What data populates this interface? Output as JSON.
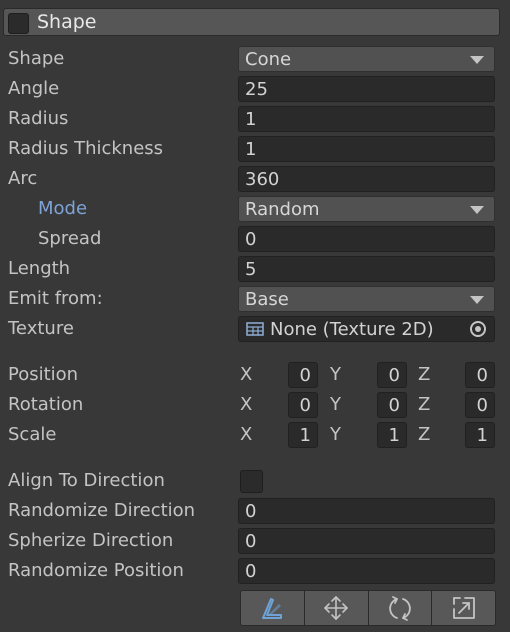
{
  "header": {
    "title": "Shape",
    "enabled": false
  },
  "fields": {
    "shape": {
      "label": "Shape",
      "value": "Cone"
    },
    "angle": {
      "label": "Angle",
      "value": "25"
    },
    "radius": {
      "label": "Radius",
      "value": "1"
    },
    "radius_thickness": {
      "label": "Radius Thickness",
      "value": "1"
    },
    "arc": {
      "label": "Arc",
      "value": "360"
    },
    "mode": {
      "label": "Mode",
      "value": "Random"
    },
    "spread": {
      "label": "Spread",
      "value": "0"
    },
    "length": {
      "label": "Length",
      "value": "5"
    },
    "emit_from": {
      "label": "Emit from:",
      "value": "Base"
    },
    "texture": {
      "label": "Texture",
      "value": "None (Texture 2D)"
    }
  },
  "transform": {
    "position": {
      "label": "Position",
      "x": "0",
      "y": "0",
      "z": "0"
    },
    "rotation": {
      "label": "Rotation",
      "x": "0",
      "y": "0",
      "z": "0"
    },
    "scale": {
      "label": "Scale",
      "x": "1",
      "y": "1",
      "z": "1"
    },
    "axis_labels": {
      "x": "X",
      "y": "Y",
      "z": "Z"
    }
  },
  "options": {
    "align_to_direction": {
      "label": "Align To Direction",
      "checked": false
    },
    "randomize_direction": {
      "label": "Randomize Direction",
      "value": "0"
    },
    "spherize_direction": {
      "label": "Spherize Direction",
      "value": "0"
    },
    "randomize_position": {
      "label": "Randomize Position",
      "value": "0"
    }
  },
  "toolbar": {
    "tools": [
      "edit-shape-icon",
      "move-icon",
      "rotate-icon",
      "scale-icon"
    ]
  },
  "colors": {
    "background": "#383838",
    "mode_label": "#7ea3d7",
    "field": "#2a2a2a",
    "dropdown": "#515151"
  }
}
